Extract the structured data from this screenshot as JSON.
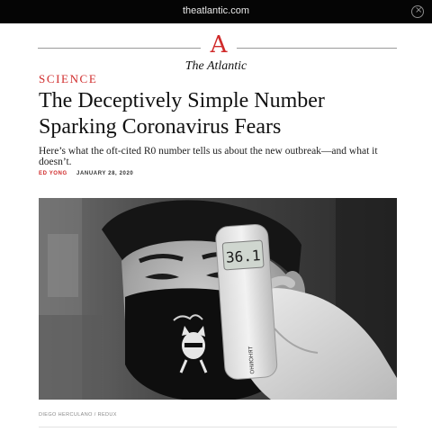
{
  "browser": {
    "url": "theatlantic.com"
  },
  "masthead": {
    "logo_letter": "A",
    "logo_word": "The Atlantic"
  },
  "article": {
    "section": "SCIENCE",
    "headline": "The Deceptively Simple Number Sparking Coronavirus Fears",
    "dek": "Here’s what the oft-cited R0 number tells us about the new outbreak—and what it doesn’t.",
    "author": "ED YONG",
    "date": "JANUARY 28, 2020",
    "photo_credit": "DIEGO HERCULANO / REDUX",
    "thermometer_reading": "36.1",
    "thermometer_brand": "ОНИОНЯТ"
  },
  "colors": {
    "accent_red": "#d02a2a",
    "topbar": "#050505"
  }
}
